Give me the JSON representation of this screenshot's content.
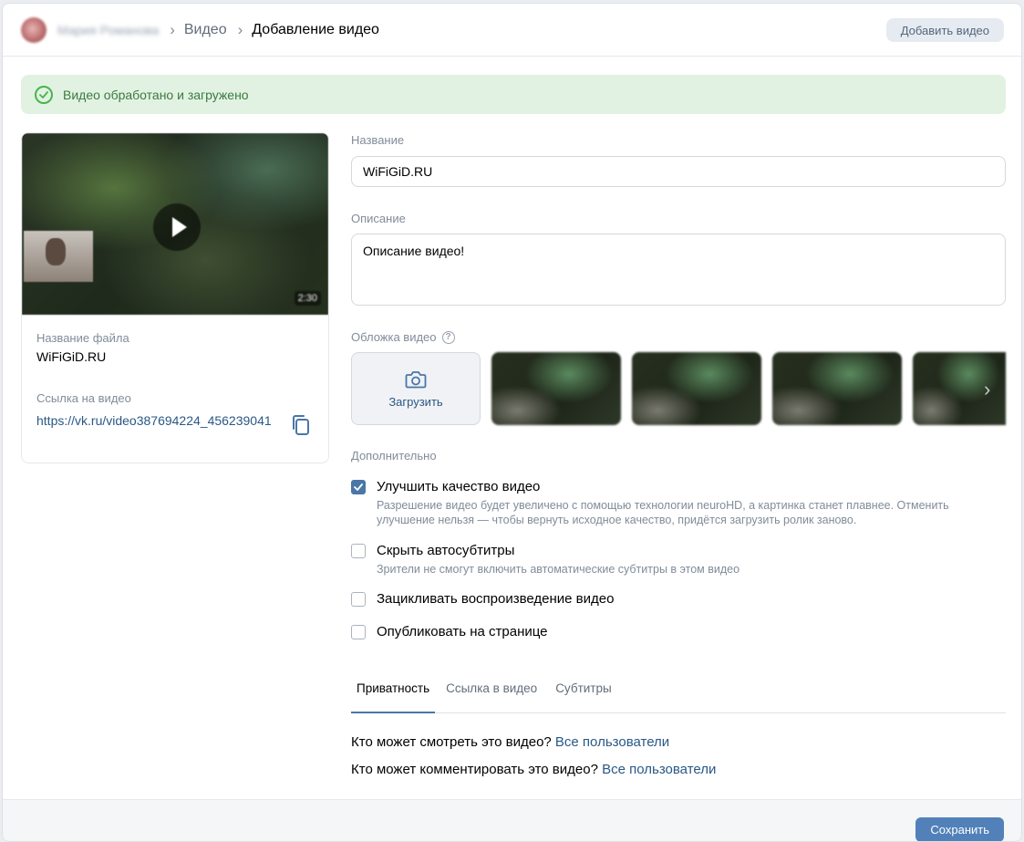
{
  "header": {
    "user_name": "Мария Романова",
    "breadcrumb": [
      "Видео",
      "Добавление видео"
    ],
    "add_video_label": "Добавить видео"
  },
  "banner": {
    "text": "Видео обработано и загружено",
    "icon": "check-circle-icon"
  },
  "video_card": {
    "duration": "2:30",
    "file_label": "Название файла",
    "file_name": "WiFiGiD.RU",
    "link_label": "Ссылка на видео",
    "link": "https://vk.ru/video387694224_456239041",
    "copy_icon": "copy-icon"
  },
  "form": {
    "title_label": "Название",
    "title_value": "WiFiGiD.RU",
    "description_label": "Описание",
    "description_value": "Описание видео!",
    "cover_label": "Обложка видео",
    "upload_label": "Загрузить",
    "extra_label": "Дополнительно"
  },
  "options": [
    {
      "title": "Улучшить качество видео",
      "hint": "Разрешение видео будет увеличено с помощью технологии neuroHD, а картинка станет плавнее. Отменить улучшение нельзя — чтобы вернуть исходное качество, придётся загрузить ролик заново.",
      "checked": true
    },
    {
      "title": "Скрыть автосубтитры",
      "hint": "Зрители не смогут включить автоматические субтитры в этом видео",
      "checked": false
    },
    {
      "title": "Зацикливать воспроизведение видео",
      "hint": "",
      "checked": false
    },
    {
      "title": "Опубликовать на странице",
      "hint": "",
      "checked": false
    }
  ],
  "tabs": [
    {
      "label": "Приватность",
      "active": true
    },
    {
      "label": "Ссылка в видео",
      "active": false
    },
    {
      "label": "Субтитры",
      "active": false
    }
  ],
  "privacy": {
    "view_question": "Кто может смотреть это видео?",
    "view_value": "Все пользователи",
    "comment_question": "Кто может комментировать это видео?",
    "comment_value": "Все пользователи"
  },
  "footer": {
    "save_label": "Сохранить"
  },
  "colors": {
    "accent": "#4a76a8",
    "link": "#2a5885",
    "success_bg": "#e1f2e3",
    "success_icon": "#4bb34b"
  }
}
